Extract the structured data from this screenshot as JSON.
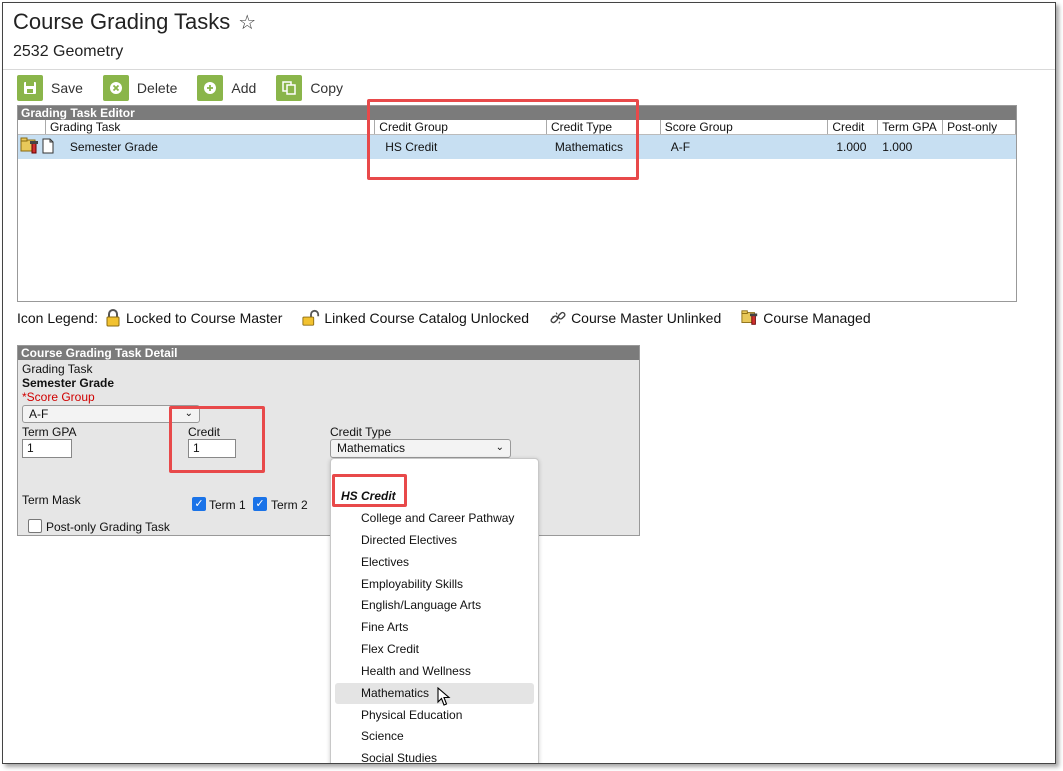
{
  "header": {
    "title": "Course Grading Tasks",
    "course": "2532 Geometry"
  },
  "toolbar": {
    "save": "Save",
    "delete": "Delete",
    "add": "Add",
    "copy": "Copy"
  },
  "editor": {
    "title": "Grading Task Editor",
    "columns": [
      "Grading Task",
      "Credit Group",
      "Credit Type",
      "Score Group",
      "Credit",
      "Term GPA",
      "Post-only"
    ],
    "rows": [
      {
        "grading_task": "Semester Grade",
        "credit_group": "HS Credit",
        "credit_type": "Mathematics",
        "score_group": "A-F",
        "credit": "1.000",
        "term_gpa": "1.000",
        "post_only": ""
      }
    ]
  },
  "legend": {
    "label": "Icon Legend:",
    "items": [
      {
        "icon": "lock-icon",
        "label": "Locked to Course Master"
      },
      {
        "icon": "unlock-icon",
        "label": "Linked Course Catalog Unlocked"
      },
      {
        "icon": "broken-link-icon",
        "label": "Course Master Unlinked"
      },
      {
        "icon": "course-managed-icon",
        "label": "Course Managed"
      }
    ]
  },
  "detail": {
    "title": "Course Grading Task Detail",
    "grading_task_label": "Grading Task",
    "grading_task_value": "Semester Grade",
    "score_group_label": "*Score Group",
    "score_group_value": "A-F",
    "term_gpa_label": "Term GPA",
    "term_gpa_value": "1",
    "credit_label": "Credit",
    "credit_value": "1",
    "credit_type_label": "Credit Type",
    "credit_type_value": "Mathematics",
    "term_mask_label": "Term Mask",
    "term1_label": "Term 1",
    "term2_label": "Term 2",
    "post_only_label": "Post-only Grading Task"
  },
  "dropdown": {
    "group": "HS Credit",
    "options": [
      "College and Career Pathway",
      "Directed Electives",
      "Electives",
      "Employability Skills",
      "English/Language Arts",
      "Fine Arts",
      "Flex Credit",
      "Health and Wellness",
      "Mathematics",
      "Physical Education",
      "Science",
      "Social Studies"
    ],
    "selected": "Mathematics"
  },
  "colors": {
    "highlight": "#e8494a",
    "toolbar_green": "#8ab54a",
    "row_selected": "#c7dff2",
    "panel_header": "#7b7b7b",
    "checkbox_blue": "#1a73e8"
  }
}
